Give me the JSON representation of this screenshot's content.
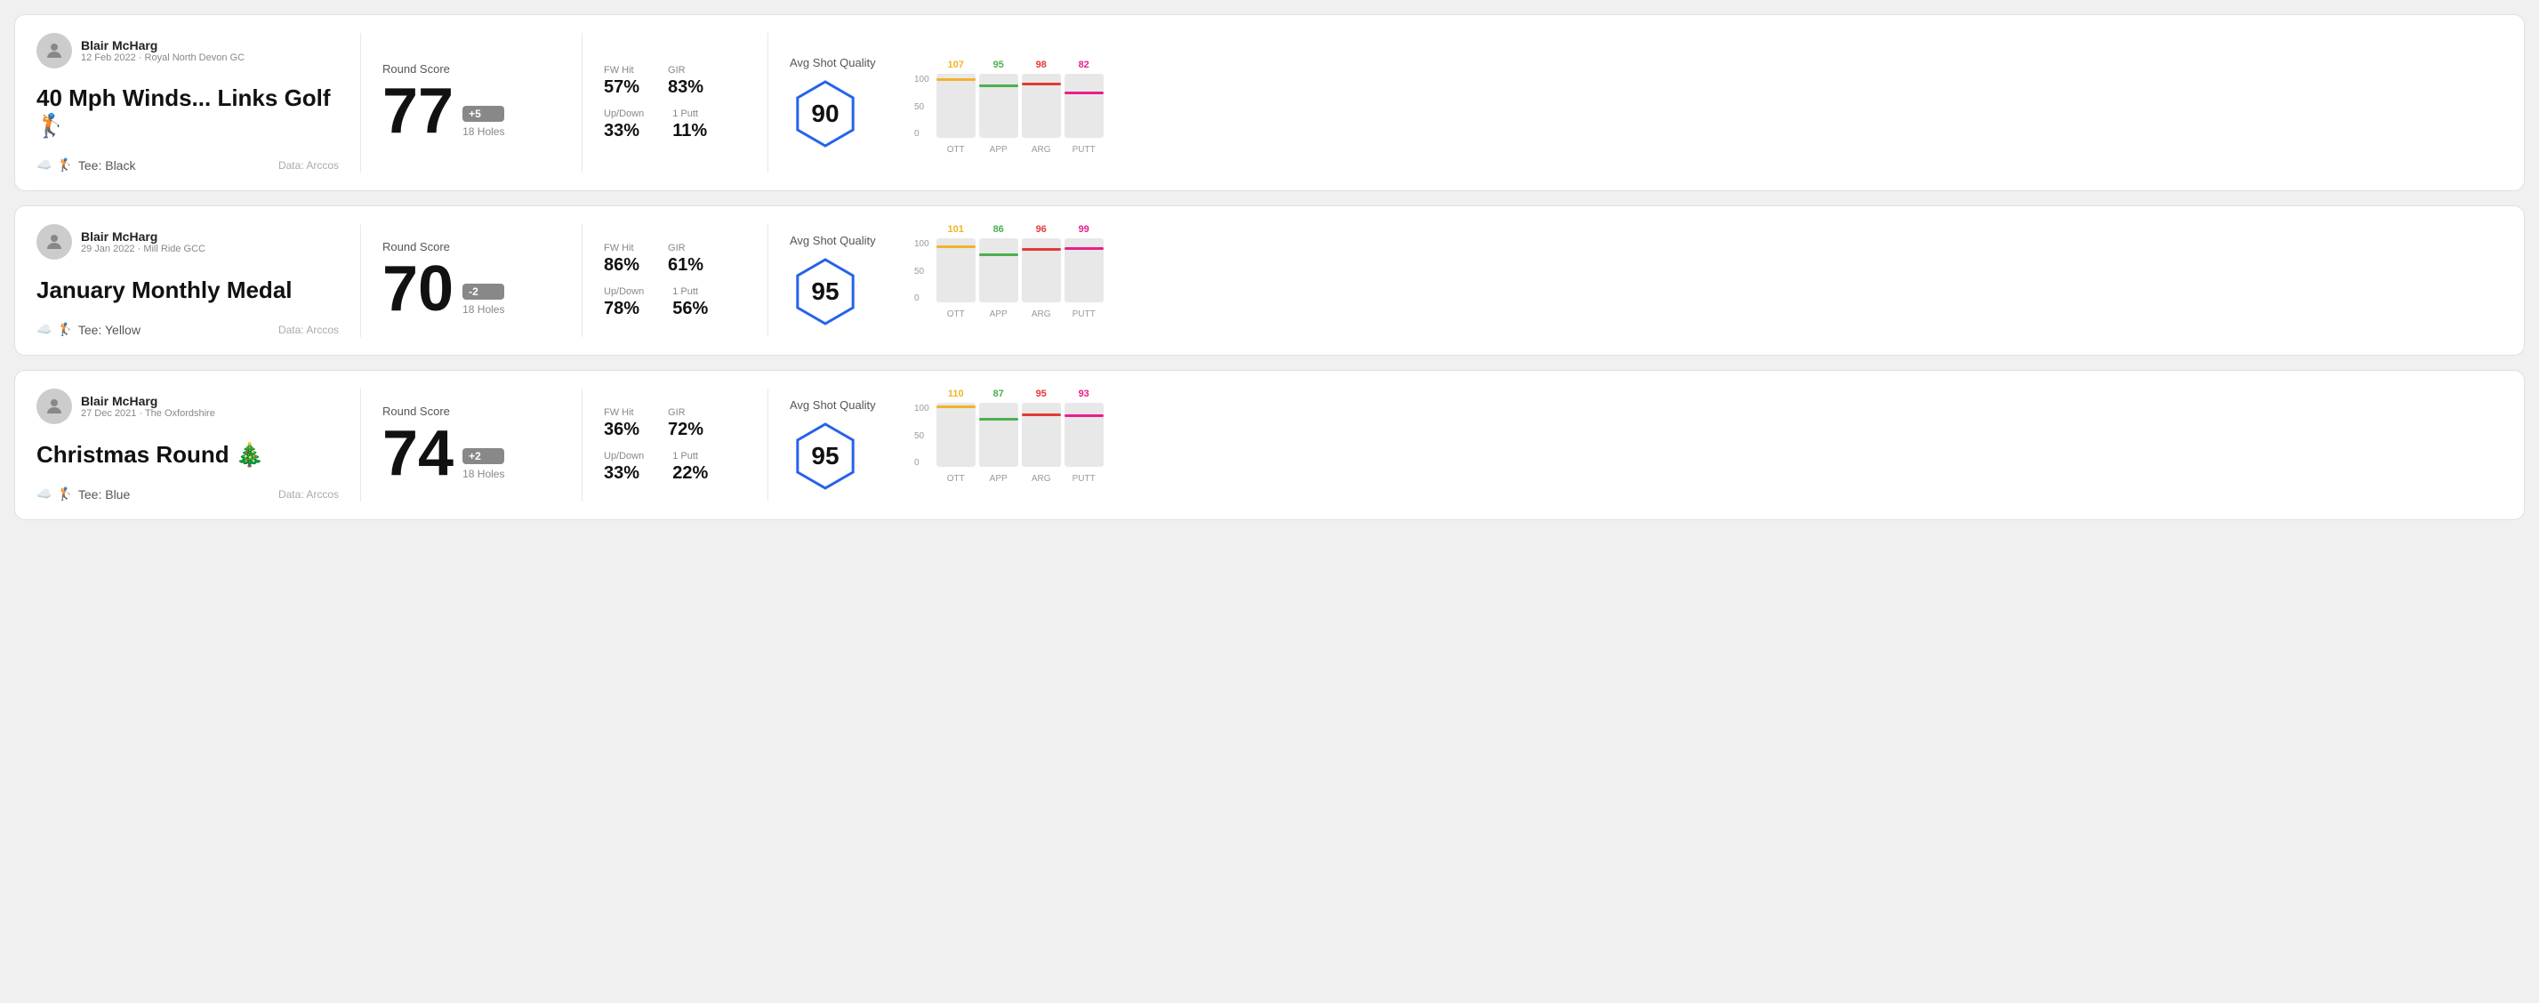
{
  "rounds": [
    {
      "id": "round-1",
      "user": {
        "name": "Blair McHarg",
        "date": "12 Feb 2022",
        "course": "Royal North Devon GC"
      },
      "title": "40 Mph Winds... Links Golf 🏌️",
      "tee": "Black",
      "data_source": "Data: Arccos",
      "score": {
        "label": "Round Score",
        "value": "77",
        "badge": "+5",
        "badge_type": "positive",
        "holes": "18 Holes"
      },
      "stats": {
        "fw_hit_label": "FW Hit",
        "fw_hit_value": "57%",
        "gir_label": "GIR",
        "gir_value": "83%",
        "updown_label": "Up/Down",
        "updown_value": "33%",
        "oneputt_label": "1 Putt",
        "oneputt_value": "11%"
      },
      "quality": {
        "label": "Avg Shot Quality",
        "score": "90"
      },
      "chart": {
        "bars": [
          {
            "label": "OTT",
            "value": 107,
            "color": "#f0b429",
            "max": 120
          },
          {
            "label": "APP",
            "value": 95,
            "color": "#4caf50",
            "max": 120
          },
          {
            "label": "ARG",
            "value": 98,
            "color": "#e53935",
            "max": 120
          },
          {
            "label": "PUTT",
            "value": 82,
            "color": "#e91e8c",
            "max": 120
          }
        ]
      }
    },
    {
      "id": "round-2",
      "user": {
        "name": "Blair McHarg",
        "date": "29 Jan 2022",
        "course": "Mill Ride GCC"
      },
      "title": "January Monthly Medal",
      "tee": "Yellow",
      "data_source": "Data: Arccos",
      "score": {
        "label": "Round Score",
        "value": "70",
        "badge": "-2",
        "badge_type": "negative",
        "holes": "18 Holes"
      },
      "stats": {
        "fw_hit_label": "FW Hit",
        "fw_hit_value": "86%",
        "gir_label": "GIR",
        "gir_value": "61%",
        "updown_label": "Up/Down",
        "updown_value": "78%",
        "oneputt_label": "1 Putt",
        "oneputt_value": "56%"
      },
      "quality": {
        "label": "Avg Shot Quality",
        "score": "95"
      },
      "chart": {
        "bars": [
          {
            "label": "OTT",
            "value": 101,
            "color": "#f0b429",
            "max": 120
          },
          {
            "label": "APP",
            "value": 86,
            "color": "#4caf50",
            "max": 120
          },
          {
            "label": "ARG",
            "value": 96,
            "color": "#e53935",
            "max": 120
          },
          {
            "label": "PUTT",
            "value": 99,
            "color": "#e91e8c",
            "max": 120
          }
        ]
      }
    },
    {
      "id": "round-3",
      "user": {
        "name": "Blair McHarg",
        "date": "27 Dec 2021",
        "course": "The Oxfordshire"
      },
      "title": "Christmas Round 🎄",
      "tee": "Blue",
      "data_source": "Data: Arccos",
      "score": {
        "label": "Round Score",
        "value": "74",
        "badge": "+2",
        "badge_type": "positive",
        "holes": "18 Holes"
      },
      "stats": {
        "fw_hit_label": "FW Hit",
        "fw_hit_value": "36%",
        "gir_label": "GIR",
        "gir_value": "72%",
        "updown_label": "Up/Down",
        "updown_value": "33%",
        "oneputt_label": "1 Putt",
        "oneputt_value": "22%"
      },
      "quality": {
        "label": "Avg Shot Quality",
        "score": "95"
      },
      "chart": {
        "bars": [
          {
            "label": "OTT",
            "value": 110,
            "color": "#f0b429",
            "max": 120
          },
          {
            "label": "APP",
            "value": 87,
            "color": "#4caf50",
            "max": 120
          },
          {
            "label": "ARG",
            "value": 95,
            "color": "#e53935",
            "max": 120
          },
          {
            "label": "PUTT",
            "value": 93,
            "color": "#e91e8c",
            "max": 120
          }
        ]
      }
    }
  ],
  "y_axis_labels": [
    "100",
    "50",
    "0"
  ]
}
